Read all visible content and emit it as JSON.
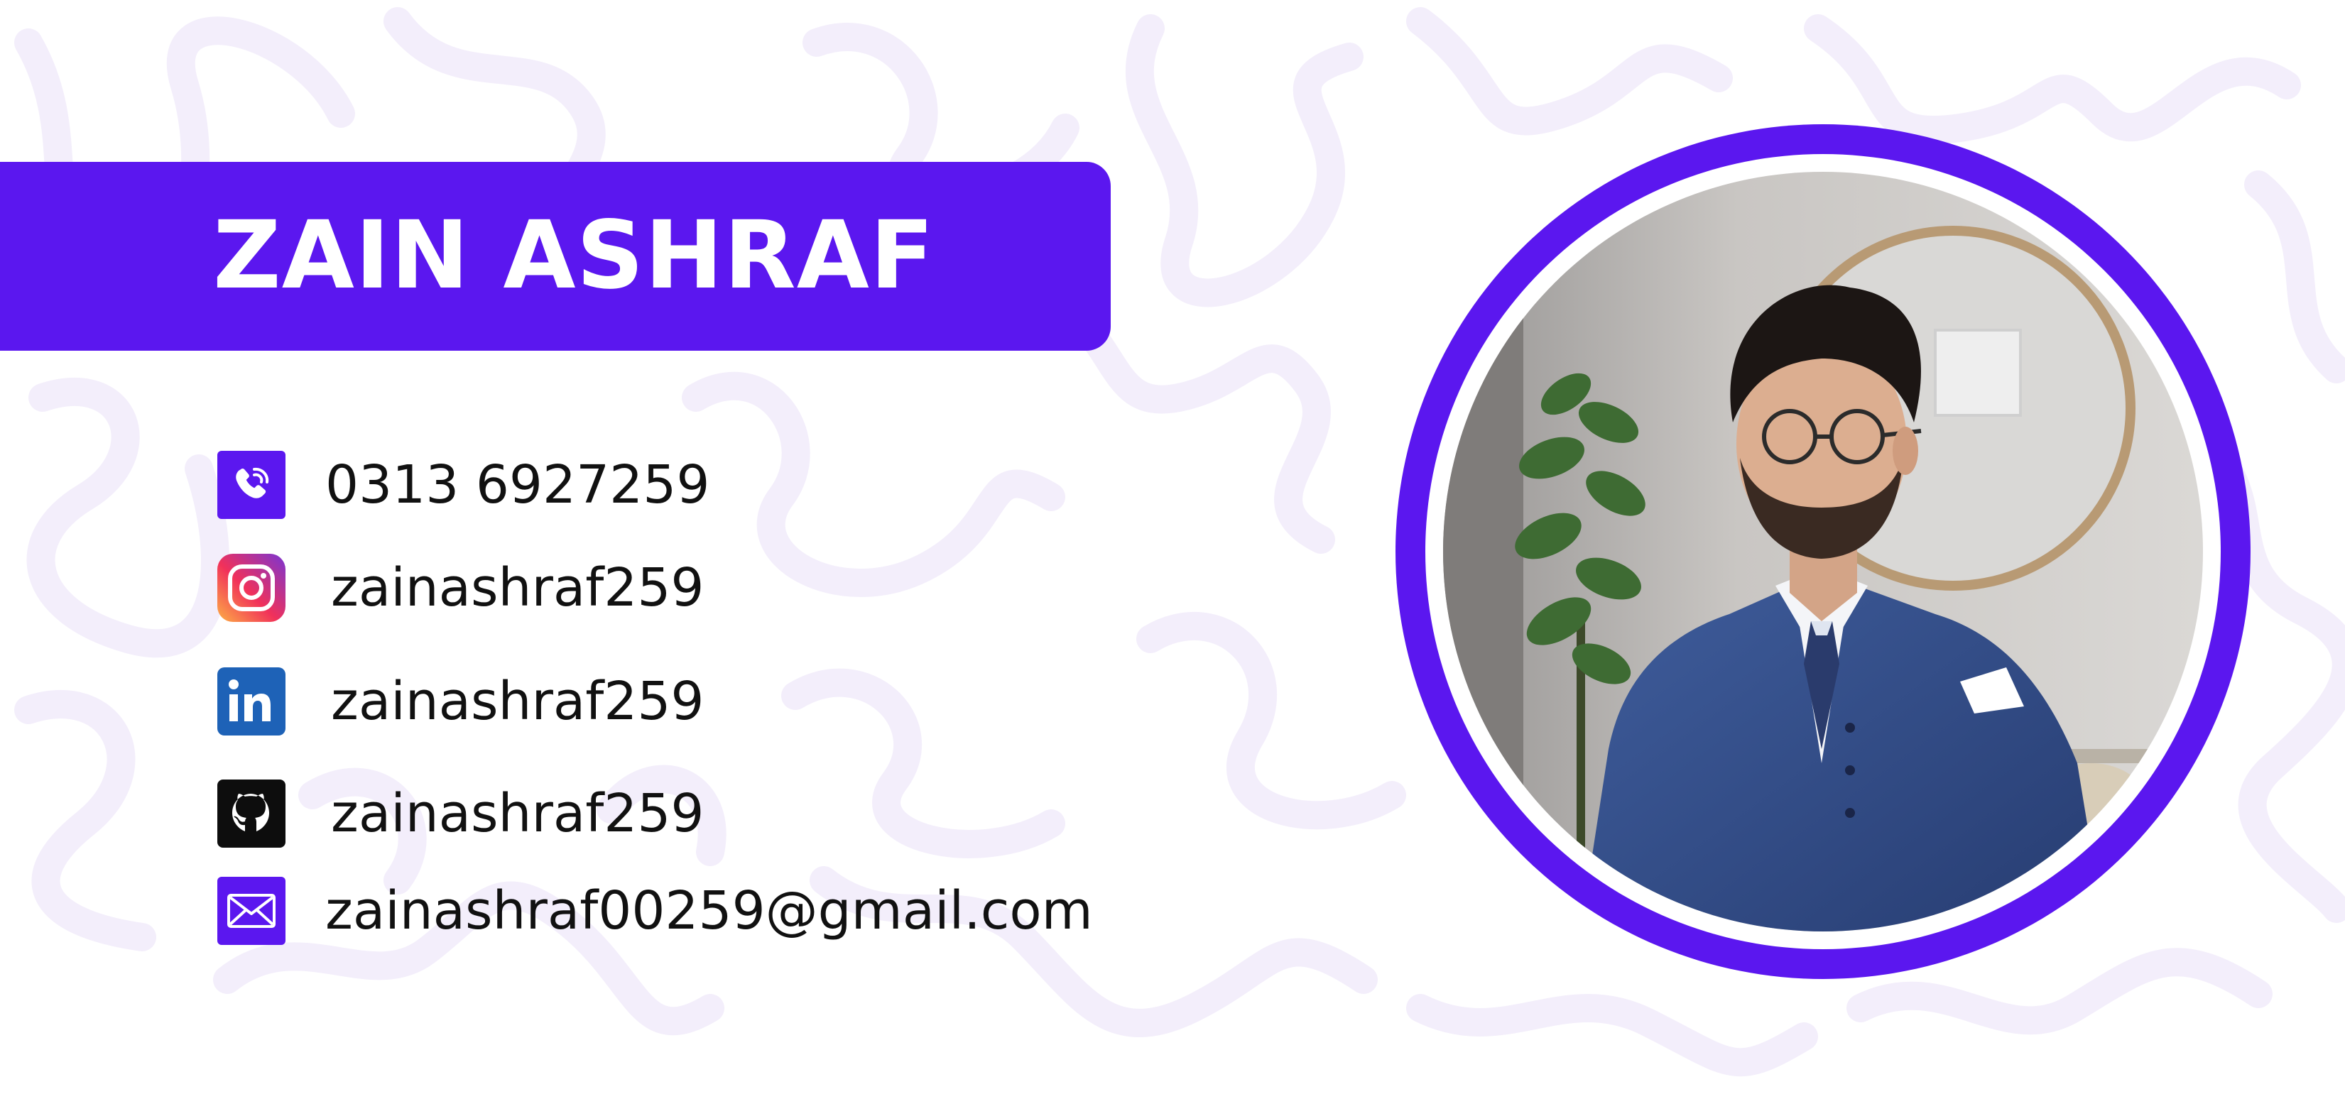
{
  "card": {
    "name": "ZAIN ASHRAF",
    "accent_color": "#5b17ef",
    "background_color": "#ffffff",
    "pattern_color": "#f4f0fb"
  },
  "contacts": [
    {
      "icon": "phone-icon",
      "value": "0313 6927259"
    },
    {
      "icon": "instagram-icon",
      "value": "zainashraf259"
    },
    {
      "icon": "linkedin-icon",
      "value": "zainashraf259"
    },
    {
      "icon": "github-icon",
      "value": "zainashraf259"
    },
    {
      "icon": "email-icon",
      "value": "zainashraf00259@gmail.com"
    }
  ],
  "portrait": {
    "subject": "profile-photo",
    "ring_color": "#5b17ef"
  }
}
